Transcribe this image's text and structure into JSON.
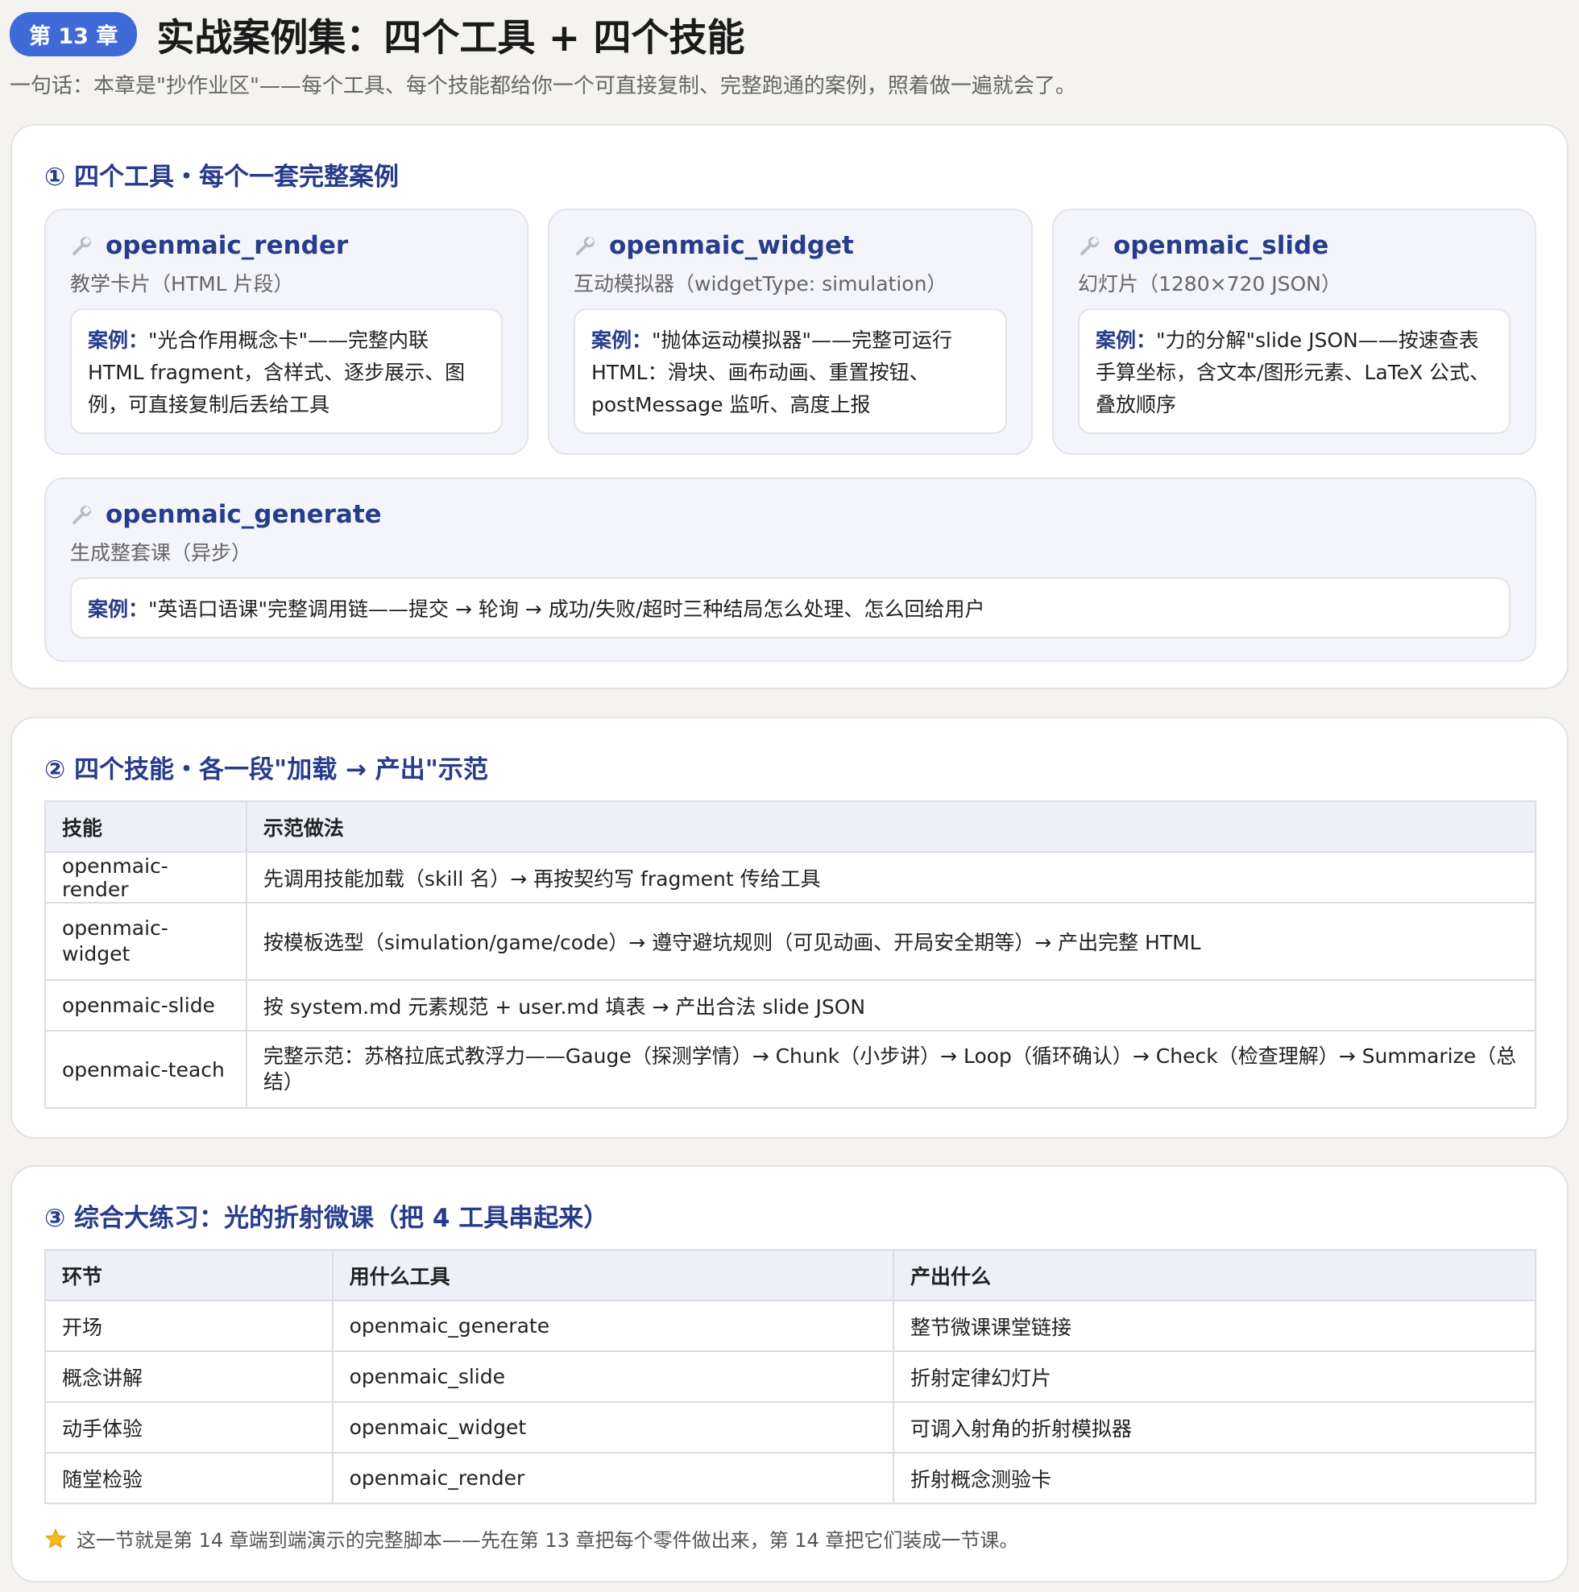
{
  "header": {
    "chapter_badge": "第 13 章",
    "title": "实战案例集：四个工具 + 四个技能",
    "subtitle": "一句话：本章是\"抄作业区\"——每个工具、每个技能都给你一个可直接复制、完整跑通的案例，照着做一遍就会了。"
  },
  "section1": {
    "title": "① 四个工具・每个一套完整案例",
    "tools": [
      {
        "name": "openmaic_render",
        "subtitle": "教学卡片（HTML 片段）",
        "example_label": "案例：",
        "example_text": "\"光合作用概念卡\"——完整内联 HTML fragment，含样式、逐步展示、图例，可直接复制后丢给工具"
      },
      {
        "name": "openmaic_widget",
        "subtitle": "互动模拟器（widgetType: simulation）",
        "example_label": "案例：",
        "example_text": "\"抛体运动模拟器\"——完整可运行 HTML：滑块、画布动画、重置按钮、postMessage 监听、高度上报"
      },
      {
        "name": "openmaic_slide",
        "subtitle": "幻灯片（1280×720 JSON）",
        "example_label": "案例：",
        "example_text": "\"力的分解\"slide JSON——按速查表手算坐标，含文本/图形元素、LaTeX 公式、叠放顺序"
      },
      {
        "name": "openmaic_generate",
        "subtitle": "生成整套课（异步）",
        "example_label": "案例：",
        "example_text": "\"英语口语课\"完整调用链——提交 → 轮询 → 成功/失败/超时三种结局怎么处理、怎么回给用户"
      }
    ]
  },
  "section2": {
    "title": "② 四个技能・各一段\"加载 → 产出\"示范",
    "headers": [
      "技能",
      "示范做法"
    ],
    "rows": [
      [
        "openmaic-render",
        "先调用技能加载（skill 名）→ 再按契约写 fragment 传给工具"
      ],
      [
        "openmaic-widget",
        "按模板选型（simulation/game/code）→ 遵守避坑规则（可见动画、开局安全期等）→ 产出完整 HTML"
      ],
      [
        "openmaic-slide",
        "按 system.md 元素规范 + user.md 填表 → 产出合法 slide JSON"
      ],
      [
        "openmaic-teach",
        "完整示范：苏格拉底式教浮力——Gauge（探测学情）→ Chunk（小步讲）→ Loop（循环确认）→ Check（检查理解）→ Summarize（总结）"
      ]
    ]
  },
  "section3": {
    "title": "③ 综合大练习：光的折射微课（把 4 工具串起来）",
    "headers": [
      "环节",
      "用什么工具",
      "产出什么"
    ],
    "rows": [
      [
        "开场",
        "openmaic_generate",
        "整节微课课堂链接"
      ],
      [
        "概念讲解",
        "openmaic_slide",
        "折射定律幻灯片"
      ],
      [
        "动手体验",
        "openmaic_widget",
        "可调入射角的折射模拟器"
      ],
      [
        "随堂检验",
        "openmaic_render",
        "折射概念测验卡"
      ]
    ],
    "note": "这一节就是第 14 章端到端演示的完整脚本——先在第 13 章把每个零件做出来，第 14 章把它们装成一节课。"
  },
  "colors": {
    "accent": "#3f6ad8",
    "heading": "#283c8c",
    "page_bg": "#f4f3ef"
  },
  "icons": [
    "wrench-icon",
    "star-icon"
  ]
}
